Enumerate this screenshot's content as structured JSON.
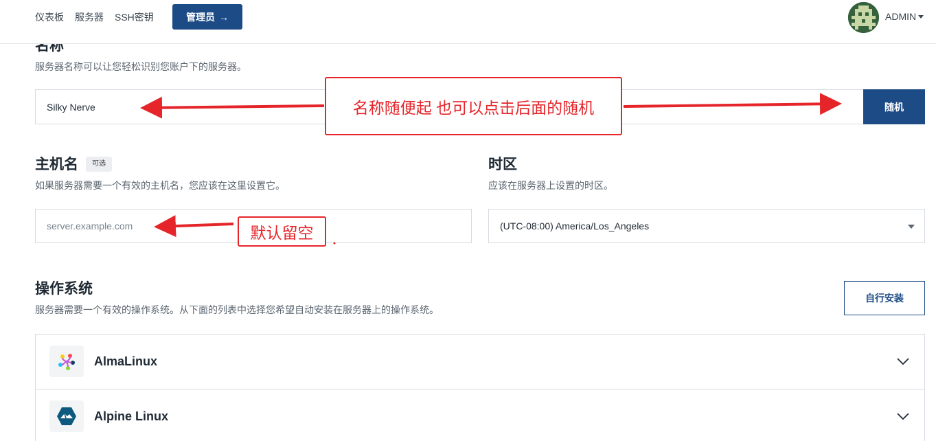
{
  "nav": {
    "links": [
      "仪表板",
      "服务器",
      "SSH密钥"
    ],
    "admin_button": "管理员",
    "admin_arrow": "→",
    "user": "ADMIN"
  },
  "name_section": {
    "title": "名称",
    "description": "服务器名称可以让您轻松识别您账户下的服务器。",
    "value": "Silky Nerve",
    "random_button": "随机"
  },
  "hostname_section": {
    "title": "主机名",
    "badge": "可选",
    "description": "如果服务器需要一个有效的主机名，您应该在这里设置它。",
    "placeholder": "server.example.com"
  },
  "timezone_section": {
    "title": "时区",
    "description": "应该在服务器上设置的时区。",
    "value": "(UTC-08:00) America/Los_Angeles"
  },
  "os_section": {
    "title": "操作系统",
    "description": "服务器需要一个有效的操作系统。从下面的列表中选择您希望自动安装在服务器上的操作系统。",
    "custom_install_button": "自行安装",
    "items": [
      {
        "name": "AlmaLinux",
        "icon": "almalinux-logo-icon"
      },
      {
        "name": "Alpine Linux",
        "icon": "alpine-linux-logo-icon"
      }
    ]
  },
  "annotations": {
    "name_note": "名称随便起 也可以点击后面的随机",
    "hostname_note": "默认留空"
  },
  "colors": {
    "primary": "#1d4b85",
    "annotation": "#e5252a"
  }
}
